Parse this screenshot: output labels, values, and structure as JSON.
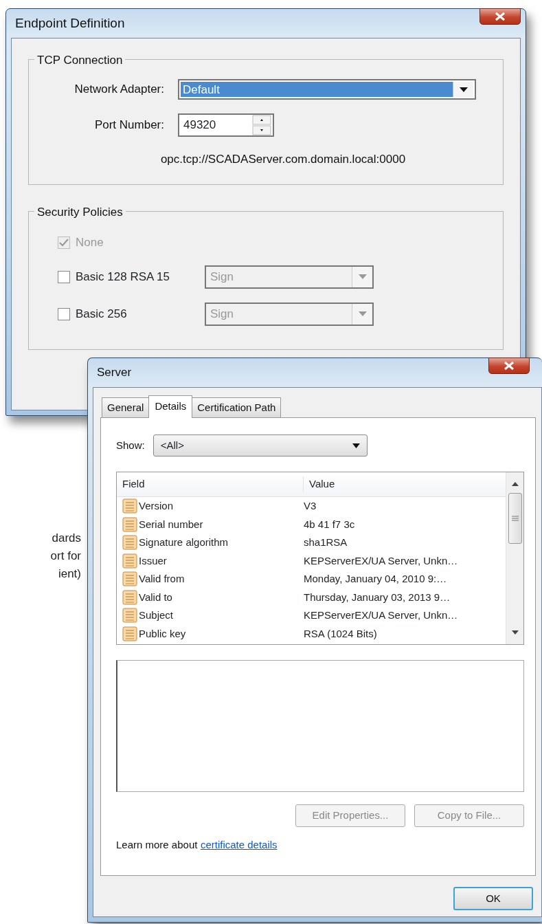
{
  "background_text": [
    "dards",
    "ort for",
    "ient)"
  ],
  "endpoint_dialog": {
    "title": "Endpoint Definition",
    "tcp_group": {
      "title": "TCP Connection",
      "network_adapter": {
        "label": "Network Adapter:",
        "value": "Default"
      },
      "port": {
        "label": "Port Number:",
        "value": "49320"
      },
      "url": "opc.tcp://SCADAServer.com.domain.local:0000"
    },
    "security_group": {
      "title": "Security Policies",
      "policies": [
        {
          "label": "None",
          "checked": true,
          "disabled": true
        },
        {
          "label": "Basic 128 RSA 15",
          "checked": false,
          "disabled": false,
          "mode": "Sign",
          "mode_disabled": true
        },
        {
          "label": "Basic 256",
          "checked": false,
          "disabled": false,
          "mode": "Sign",
          "mode_disabled": true
        }
      ]
    }
  },
  "certificate_dialog": {
    "title": "Server",
    "tabs": [
      {
        "label": "General",
        "selected": false
      },
      {
        "label": "Details",
        "selected": true
      },
      {
        "label": "Certification Path",
        "selected": false
      }
    ],
    "show": {
      "label": "Show:",
      "value": "<All>"
    },
    "columns": [
      "Field",
      "Value"
    ],
    "rows": [
      {
        "field": "Version",
        "value": "V3"
      },
      {
        "field": "Serial number",
        "value": "4b 41 f7 3c"
      },
      {
        "field": "Signature algorithm",
        "value": "sha1RSA"
      },
      {
        "field": "Issuer",
        "value": "KEPServerEX/UA Server, Unkn…"
      },
      {
        "field": "Valid from",
        "value": "Monday, January 04, 2010 9:…"
      },
      {
        "field": "Valid to",
        "value": "Thursday, January 03, 2013 9…"
      },
      {
        "field": "Subject",
        "value": "KEPServerEX/UA Server, Unkn…"
      },
      {
        "field": "Public key",
        "value": "RSA (1024 Bits)"
      }
    ],
    "buttons": [
      {
        "label": "Edit Properties...",
        "disabled": true
      },
      {
        "label": "Copy to File...",
        "disabled": true
      }
    ],
    "learn_more": {
      "text": "Learn more about",
      "link": "certificate details"
    },
    "ok_button": "OK"
  }
}
